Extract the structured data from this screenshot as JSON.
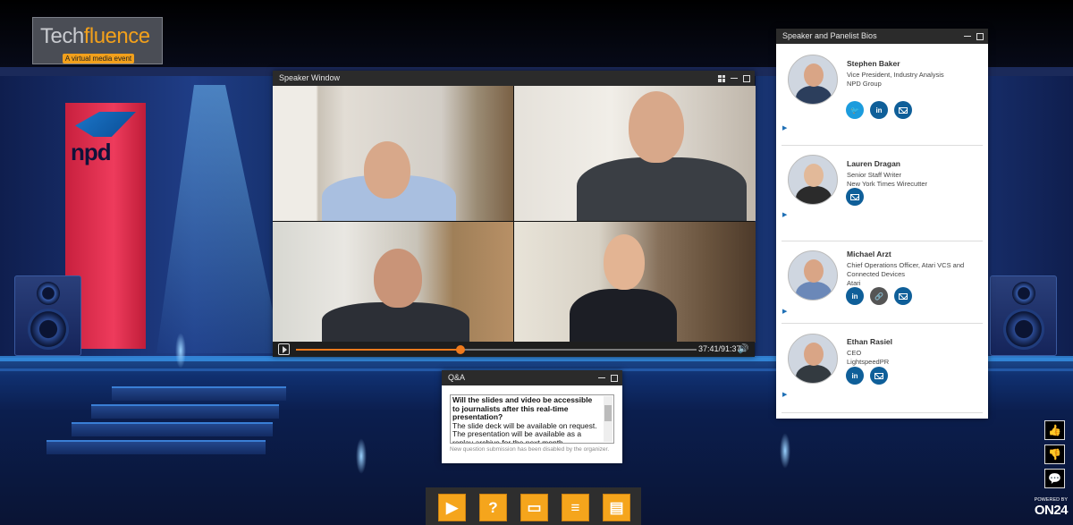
{
  "event_logo": {
    "brand_part1": "Tech",
    "brand_part2": "fluence",
    "tagline": "A virtual media event"
  },
  "sponsor_logo": {
    "text": "npd"
  },
  "speaker_window": {
    "title": "Speaker Window",
    "timecode": "37:41/91:37",
    "progress_fraction": 0.41
  },
  "bios": {
    "title": "Speaker and Panelist Bios",
    "people": [
      {
        "name": "Stephen Baker",
        "title_lines": [
          "Vice President, Industry Analysis",
          "NPD Group"
        ],
        "icons": [
          "twitter-icon",
          "linkedin-icon",
          "email-icon"
        ]
      },
      {
        "name": "Lauren Dragan",
        "title_lines": [
          "Senior Staff Writer",
          "New York Times Wirecutter"
        ],
        "icons": [
          "email-icon"
        ]
      },
      {
        "name": "Michael Arzt",
        "title_lines": [
          "Chief Operations Officer, Atari VCS and",
          "Connected Devices",
          "Atari"
        ],
        "icons": [
          "linkedin-icon",
          "link-icon",
          "email-icon"
        ]
      },
      {
        "name": "Ethan Rasiel",
        "title_lines": [
          "CEO",
          "LightspeedPR"
        ],
        "icons": [
          "linkedin-icon",
          "email-icon"
        ]
      }
    ]
  },
  "qa": {
    "title": "Q&A",
    "question": "Will the slides and video be accessible to journalists after this real-time presentation?",
    "answer": "The slide deck will be available on request. The presentation will be available as a replay archive for the next month.",
    "note": "New question submission has been disabled by the organizer."
  },
  "dock": {
    "buttons": [
      {
        "name": "media-player-button",
        "icon": "film-play-icon",
        "glyph": "▶"
      },
      {
        "name": "qa-button",
        "icon": "question-icon",
        "glyph": "?"
      },
      {
        "name": "slides-button",
        "icon": "slides-icon",
        "glyph": "▭"
      },
      {
        "name": "resources-button",
        "icon": "document-icon",
        "glyph": "≡"
      },
      {
        "name": "bios-button",
        "icon": "contact-card-icon",
        "glyph": "▤"
      }
    ]
  },
  "rail": {
    "like": "👍",
    "dislike": "👎",
    "chat": "💬"
  },
  "powered_by": {
    "line1": "POWERED BY",
    "line2": "ON24"
  },
  "colors": {
    "accent": "#f5a51c",
    "progress": "#f07a1c",
    "link_blue": "#0f5f99",
    "twitter": "#1c9cdd"
  }
}
